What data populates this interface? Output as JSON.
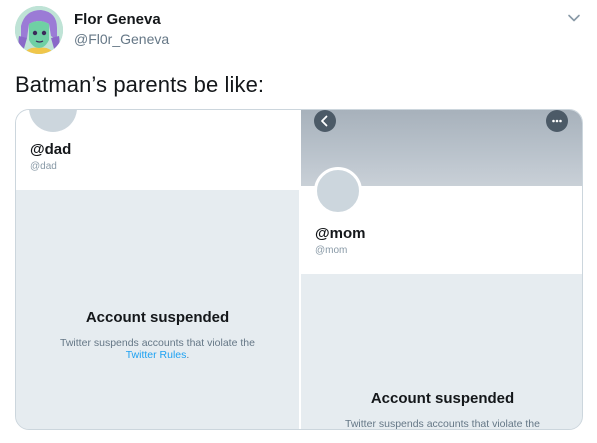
{
  "tweet": {
    "display_name": "Flor Geneva",
    "handle": "@Fl0r_Geneva",
    "text": "Batman’s parents be like:"
  },
  "icons": {
    "menu": "chevron-down-icon",
    "back": "chevron-left-icon",
    "more": "more-horizontal-icon"
  },
  "media": {
    "left": {
      "name": "@dad",
      "handle": "@dad",
      "suspended_title": "Account suspended",
      "suspended_text": "Twitter suspends accounts that violate the",
      "rules_link": "Twitter Rules",
      "rules_suffix": "."
    },
    "right": {
      "name": "@mom",
      "handle": "@mom",
      "suspended_title": "Account suspended",
      "suspended_text": "Twitter suspends accounts that violate the"
    }
  },
  "colors": {
    "link": "#1da1f2",
    "suspended_bg": "#e6ecf0",
    "placeholder_avatar": "#ccd6dd"
  }
}
